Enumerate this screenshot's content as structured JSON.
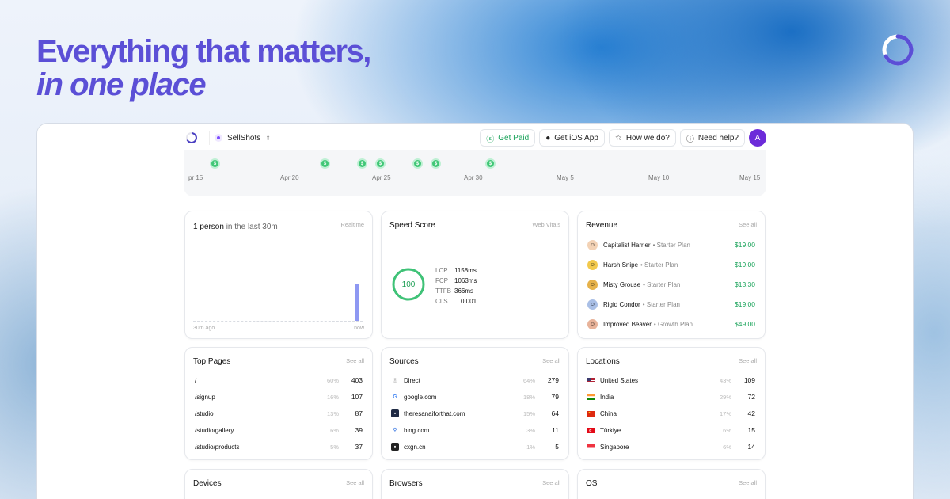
{
  "headline": {
    "line1": "Everything that matters,",
    "line2": "in one place"
  },
  "colors": {
    "accent": "#5b4fd6",
    "brand": "#6c2bd9",
    "positive": "#1aa35a"
  },
  "topbar": {
    "site": "SellShots",
    "buttons": [
      "Get Paid",
      "Get iOS App",
      "How we do?",
      "Need help?"
    ],
    "avatar": "A"
  },
  "timeline": {
    "labels": [
      "pr 15",
      "Apr 20",
      "Apr 25",
      "Apr 30",
      "May 5",
      "May 10",
      "May 15"
    ]
  },
  "realtime": {
    "count": "1 person",
    "suffix": " in the last 30m",
    "link": "Realtime",
    "start": "30m ago",
    "end": "now",
    "level": 0.9
  },
  "speed": {
    "title": "Speed Score",
    "link": "Web Vitals",
    "score": "100",
    "vitals": [
      {
        "k": "LCP",
        "v": "1158ms"
      },
      {
        "k": "FCP",
        "v": "1063ms"
      },
      {
        "k": "TTFB",
        "v": "366ms"
      },
      {
        "k": "CLS",
        "v": "0.001"
      }
    ]
  },
  "revenue": {
    "title": "Revenue",
    "link": "See all",
    "rows": [
      {
        "name": "Capitalist Harrier",
        "plan": "• Starter Plan",
        "amount": "$19.00"
      },
      {
        "name": "Harsh Snipe",
        "plan": "• Starter Plan",
        "amount": "$19.00"
      },
      {
        "name": "Misty Grouse",
        "plan": "• Starter Plan",
        "amount": "$13.30"
      },
      {
        "name": "Rigid Condor",
        "plan": "• Starter Plan",
        "amount": "$19.00"
      },
      {
        "name": "Improved Beaver",
        "plan": "• Growth Plan",
        "amount": "$49.00"
      }
    ]
  },
  "top_pages": {
    "title": "Top Pages",
    "link": "See all",
    "rows": [
      {
        "label": "/",
        "pct": "60%",
        "count": "403"
      },
      {
        "label": "/signup",
        "pct": "16%",
        "count": "107"
      },
      {
        "label": "/studio",
        "pct": "13%",
        "count": "87"
      },
      {
        "label": "/studio/gallery",
        "pct": "6%",
        "count": "39"
      },
      {
        "label": "/studio/products",
        "pct": "5%",
        "count": "37"
      }
    ]
  },
  "sources": {
    "title": "Sources",
    "link": "See all",
    "rows": [
      {
        "label": "Direct",
        "pct": "64%",
        "count": "279",
        "icon": "globe-icon"
      },
      {
        "label": "google.com",
        "pct": "18%",
        "count": "79",
        "icon": "google-icon"
      },
      {
        "label": "theresanaiforthat.com",
        "pct": "15%",
        "count": "64",
        "icon": "site-icon"
      },
      {
        "label": "bing.com",
        "pct": "3%",
        "count": "11",
        "icon": "bing-icon"
      },
      {
        "label": "cxgn.cn",
        "pct": "1%",
        "count": "5",
        "icon": "site-icon"
      }
    ]
  },
  "locations": {
    "title": "Locations",
    "link": "See all",
    "rows": [
      {
        "label": "United States",
        "pct": "43%",
        "count": "109"
      },
      {
        "label": "India",
        "pct": "29%",
        "count": "72"
      },
      {
        "label": "China",
        "pct": "17%",
        "count": "42"
      },
      {
        "label": "Türkiye",
        "pct": "6%",
        "count": "15"
      },
      {
        "label": "Singapore",
        "pct": "6%",
        "count": "14"
      }
    ]
  },
  "bottom_cards": [
    {
      "title": "Devices",
      "link": "See all"
    },
    {
      "title": "Browsers",
      "link": "See all"
    },
    {
      "title": "OS",
      "link": "See all"
    }
  ]
}
